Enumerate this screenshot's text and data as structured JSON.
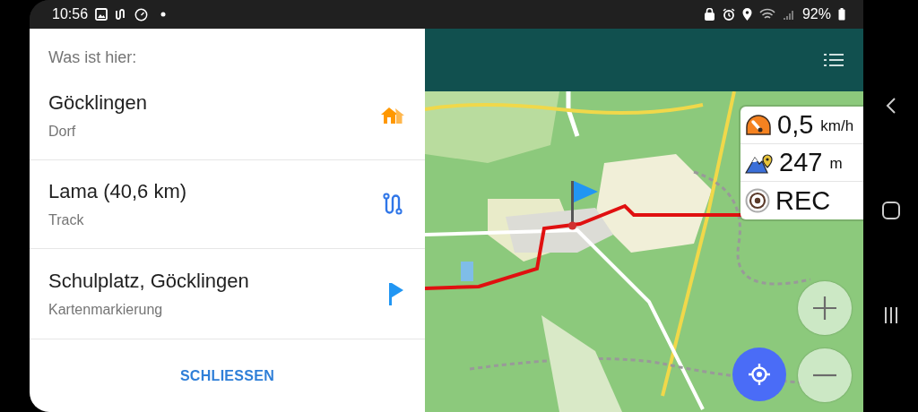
{
  "status_bar": {
    "time": "10:56",
    "battery": "92%"
  },
  "panel": {
    "title": "Was ist hier:",
    "items": [
      {
        "kind": "place",
        "title": "Göcklingen",
        "subtitle": "Dorf"
      },
      {
        "kind": "track",
        "title": "Lama (40,6 km)",
        "subtitle": "Track"
      },
      {
        "kind": "marker",
        "title": "Schulplatz, Göcklingen",
        "subtitle": "Kartenmarkierung"
      }
    ],
    "close_button": "SCHLIESSEN"
  },
  "map": {
    "widgets": [
      {
        "kind": "speed",
        "value": "0,5",
        "unit": "km/h"
      },
      {
        "kind": "altitude",
        "value": "247",
        "unit": "m"
      },
      {
        "kind": "recording",
        "value": "REC"
      }
    ]
  }
}
